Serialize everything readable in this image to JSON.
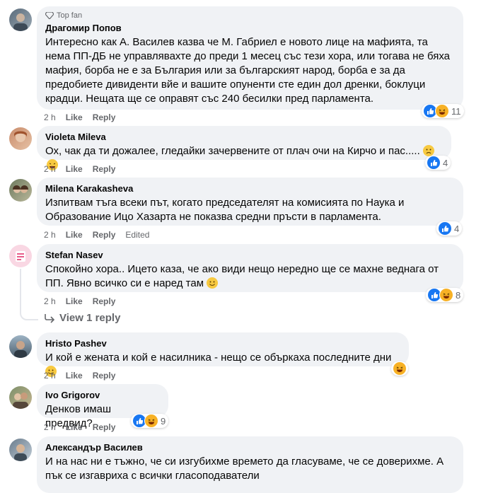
{
  "comments": [
    {
      "author": "Драгомир Попов",
      "badge": "Top fan",
      "text": "Интересно как А. Василев казва че М. Габриел е новото лице на мафията, та нема ПП-ДБ не управлявахте до преди 1 месец със тези хора, или тогава не бяха мафия, борба не е за България или за българският народ, борба е за да предобиете дивиденти вйе и вашите опуненти сте един дол дренки, боклуци крадци. Нещата ще се оправят със 240 бесилки пред парламента.",
      "time": "2 h",
      "like": "Like",
      "reply": "Reply",
      "reactions": [
        "like-icon",
        "haha-icon"
      ],
      "count": "11"
    },
    {
      "author": "Violeta Mileva",
      "text": "Ох, чак да ти дожалее, гледайки зачервените от плач очи на Кирчо и пас.....",
      "time": "2 h",
      "like": "Like",
      "reply": "Reply",
      "reactions": [
        "like-icon"
      ],
      "count": "4"
    },
    {
      "author": "Milena Karakasheva",
      "text": "Изпитвам тъга всеки път, когато председателят на комисията по Наука и Образование Ицо Хазарта не показва средни пръсти в парламента.",
      "time": "2 h",
      "like": "Like",
      "reply": "Reply",
      "edited": "Edited",
      "reactions": [
        "like-icon"
      ],
      "count": "4"
    },
    {
      "author": "Stefan Nasev",
      "text": "Спокойно хора.. Ицето каза, че ако види нещо нередно ще се махне веднага от ПП. Явно всичко си е наред там",
      "time": "2 h",
      "like": "Like",
      "reply": "Reply",
      "reactions": [
        "like-icon",
        "haha-icon"
      ],
      "count": "8",
      "view_replies": "View 1 reply"
    },
    {
      "author": "Hristo Pashev",
      "text": "И кой е жената и кой е насилника - нещо се объркаха последните дни",
      "time": "2 h",
      "like": "Like",
      "reply": "Reply",
      "reactions": [
        "haha-icon"
      ],
      "count": ""
    },
    {
      "author": "Ivo Grigorov",
      "text": "Денков имаш предвид?",
      "time": "2 h",
      "like": "Like",
      "reply": "Reply",
      "reactions": [
        "like-icon",
        "haha-icon"
      ],
      "count": "9"
    },
    {
      "author": "Александър Василев",
      "text": "И на нас ни е тъжно, че си изгубихме времето да гласуваме, че се доверихме. А пък се изгавриха с всички гласоподаватели"
    }
  ],
  "colors": {
    "bubble": "#f0f2f5",
    "like_blue": "#1877f2",
    "emoji_yellow": "#f7c940",
    "muted": "#65676b"
  }
}
